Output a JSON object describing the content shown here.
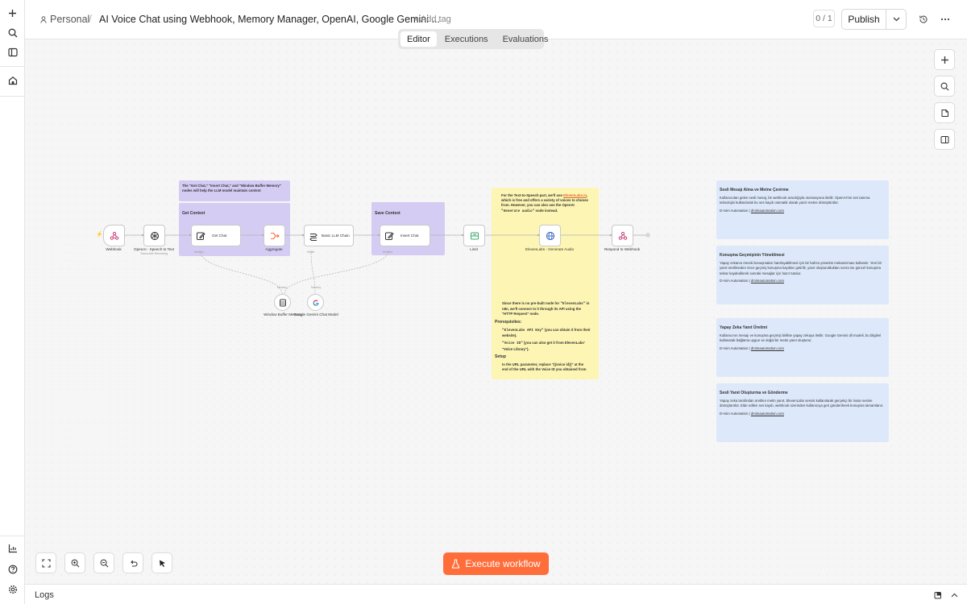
{
  "header": {
    "project": "Personal",
    "separator": "/",
    "title": "AI Voice Chat using Webhook, Memory Manager, OpenAI, Google Gemini ...",
    "add_tag": "+ Add tag",
    "version": "0 / 1",
    "publish": "Publish"
  },
  "tabs": [
    "Editor",
    "Executions",
    "Evaluations"
  ],
  "active_tab": "Editor",
  "canvas": {
    "groups": {
      "get_context": "Get Context",
      "save_context": "Save Context"
    },
    "notes": {
      "memory_note": "The \"Get Chat,\" \"Insert Chat,\" and \"Window Buffer Memory\" nodes will help the LLM model maintain context",
      "eleven_intro_1": "For the Text-to-Speech part, we'll use",
      "eleven_link": "ElevenLabs.io",
      "eleven_intro_2": ", which is free and offers a variety of voices to choose from. However, you can also use the OpenAI",
      "eleven_code_1": "\"Generate audio\"",
      "eleven_intro_3": "node instead.",
      "eleven_p2_1": "Since there is no pre-built node for",
      "eleven_code_2": "\"ElevenLabs\"",
      "eleven_p2_2": "in n8n, we'll connect to it through its API using the \"HTTP Request\" node.",
      "prereq_title": "Prerequisites:",
      "prereq_1_code": "\"ElevenLabs API Key\"",
      "prereq_1_text": "(you can obtain it from their website).",
      "prereq_2_code": "\"Voice ID\"",
      "prereq_2_text": "(you can also get it from ElevenLabs' \"Voice Library\").",
      "setup_title": "Setup",
      "setup_text": "In the URL parameter, replace \"{{voice id}}\" at the end of the URL with the Voice ID you obtained from"
    },
    "blue_notes": [
      {
        "title": "Sesli Mesajı Alma ve Metne Çevirme",
        "body": "Kullanıcıdan gelen sesli mesaj, bir webhook aracılığıyla otomasyona iletilir. OpenAI'nin ses tanıma teknolojisi kullanılarak bu ses kaydı otomatik olarak yazılı metne dönüştürülür.",
        "credit": "D-mim Automation |",
        "link": "dmimautomation.com"
      },
      {
        "title": "Konuşma Geçmişinin Yönetilmesi",
        "body": "Yapay zekanın önceki konuşmaları hatırlayabilmesi için bir hafıza yönetimi mekanizması kullanılır. Yeni bir yanıt üretilmeden önce geçmiş konuşma kayıtları getirilir, yanıt oluşturulduktan sonra ise güncel konuşma tekrar kaydedilerek sonraki mesajlar için hazır tutulur.",
        "credit": "D-mim Automation |",
        "link": "dmimautomation.com"
      },
      {
        "title": "Yapay Zeka Yanıt Üretimi",
        "body": "Kullanıcının mesajı ve konuşma geçmişi birlikte yapay zekaya iletilir. Google Gemini dil modeli, bu bilgileri kullanarak bağlama uygun ve doğal bir metin yanıt oluşturur.",
        "credit": "D-mim Automation |",
        "link": "dmimautomation.com"
      },
      {
        "title": "Sesli Yanıt Oluşturma ve Gönderme",
        "body": "Yapay zeka tarafından üretilen metin yanıt, ElevenLabs servisi kullanılarak gerçekçi bir insan sesine dönüştürülür. Elde edilen ses kaydı, webhook üzerinden kullanıcıya geri gönderilerek konuşma tamamlanır.",
        "credit": "D-mim Automation |",
        "link": "dmimautomation.com"
      }
    ],
    "nodes": {
      "webhook": "Webhook",
      "openai": "OpenAI - Speech to Text",
      "openai_sub": "Transcribe Recording",
      "get_chat": "Get Chat",
      "aggregate": "Aggregate",
      "llm_chain": "Basic LLM Chain",
      "insert_chat": "Insert Chat",
      "limit": "Limit",
      "elevenlabs": "ElevenLabs - Generate Audio",
      "respond": "Respond to Webhook",
      "window_memory": "Window Buffer Memory",
      "gemini": "Google Gemini Chat Model"
    },
    "connection_labels": {
      "memory_a": "Memory",
      "model": "Model",
      "memory_b": "Memory",
      "memory_c": "Memory",
      "memory_d": "Memory"
    }
  },
  "execute_label": "Execute workflow",
  "logs_label": "Logs"
}
